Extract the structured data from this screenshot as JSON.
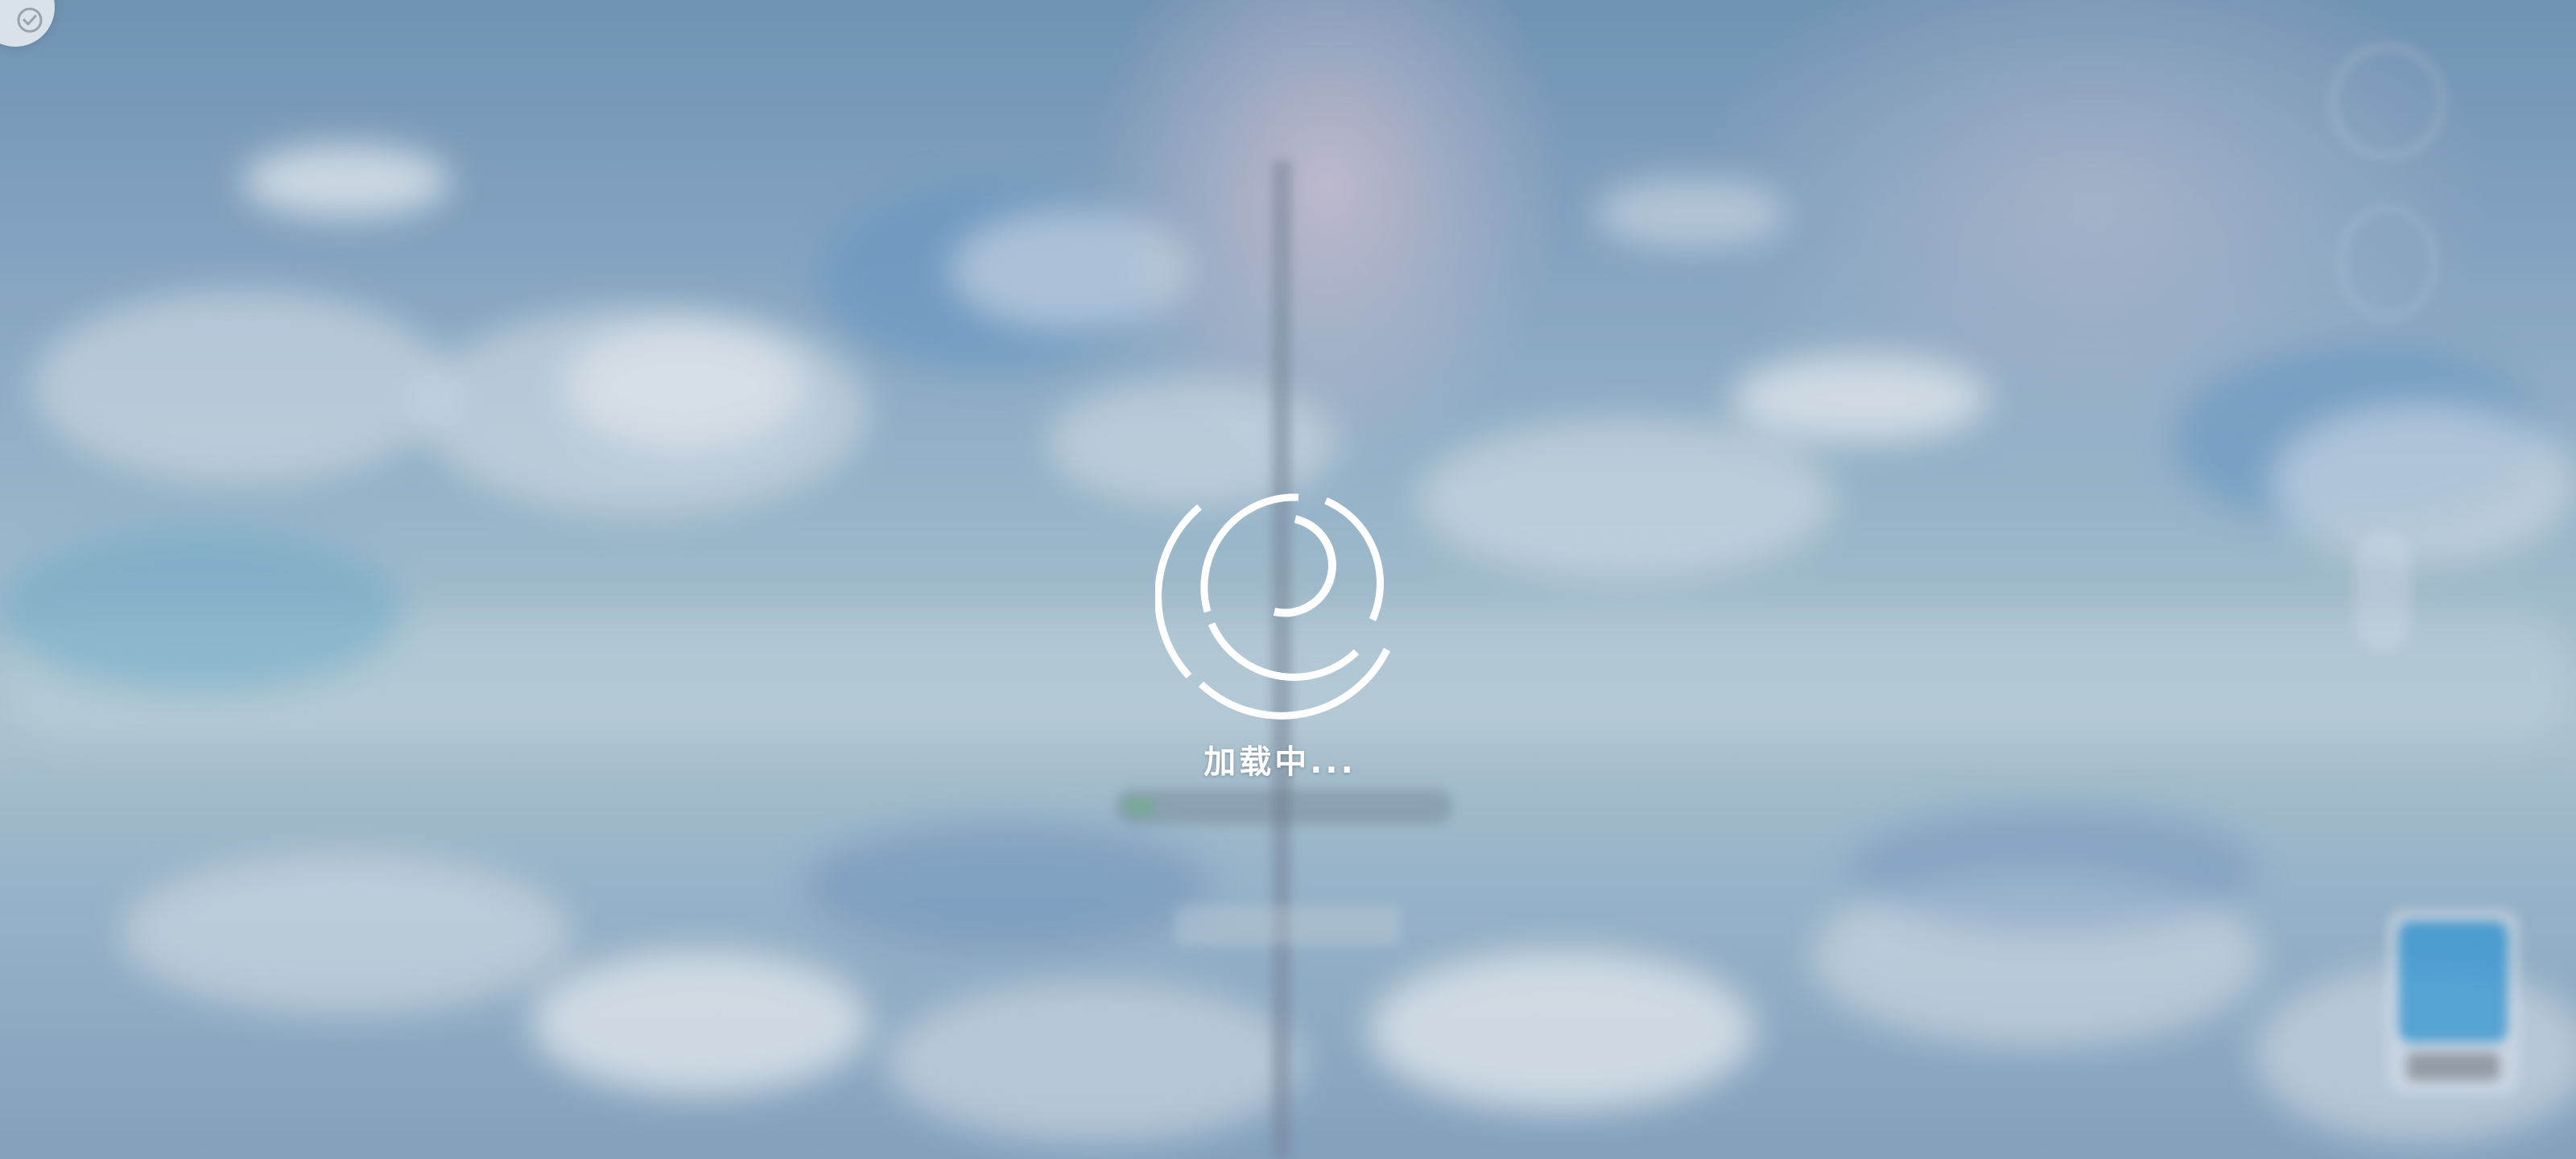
{
  "loading": {
    "label": "加载中..."
  },
  "corner_button": {
    "icon": "shield-check-icon"
  },
  "colors": {
    "loading_text": "#ffffff",
    "spinner": "#ffffff",
    "sky_top": "#6f96b8",
    "sky_horizon": "#b7cfd8"
  }
}
